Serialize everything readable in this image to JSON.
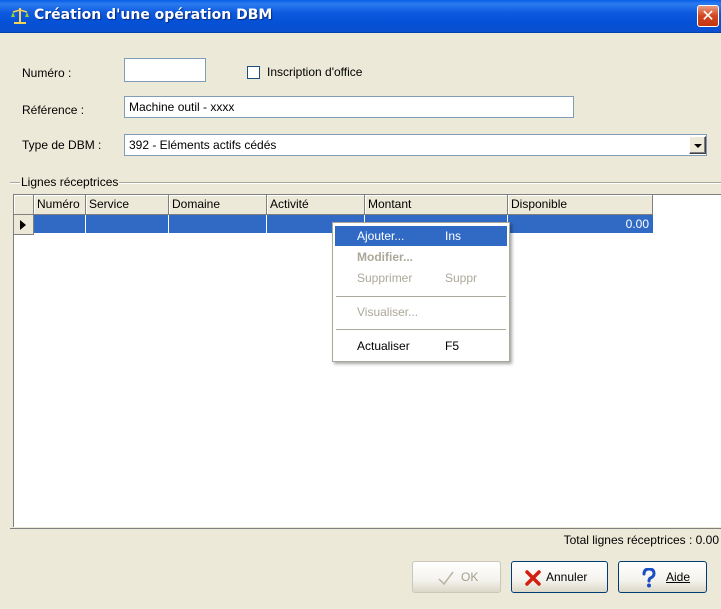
{
  "window": {
    "title": "Création d'une opération DBM",
    "close_glyph": "✕"
  },
  "form": {
    "numero_label": "Numéro :",
    "numero_value": "",
    "inscription_label": "Inscription d'office",
    "inscription_checked": false,
    "reference_label": "Référence :",
    "reference_value": "Machine outil  - xxxx",
    "type_label": "Type de DBM :",
    "type_value": "392 - Eléments actifs cédés"
  },
  "group": {
    "label": "Lignes réceptrices"
  },
  "grid": {
    "columns": [
      "Numéro",
      "Service",
      "Domaine",
      "Activité",
      "Montant",
      "Disponible"
    ],
    "rows": [
      {
        "numero": "",
        "service": "",
        "domaine": "",
        "activite": "",
        "montant": "",
        "disponible": "0.00",
        "selected": true
      }
    ]
  },
  "total": {
    "text": "Total lignes réceptrices : 0.00"
  },
  "context_menu": {
    "items": [
      {
        "label": "Ajouter...",
        "shortcut": "Ins",
        "state": "highlighted"
      },
      {
        "label": "Modifier...",
        "shortcut": "",
        "state": "disabled-bold"
      },
      {
        "label": "Supprimer",
        "shortcut": "Suppr",
        "state": "disabled"
      },
      {
        "label": "Visualiser...",
        "shortcut": "",
        "state": "disabled"
      },
      {
        "label": "Actualiser",
        "shortcut": "F5",
        "state": "enabled"
      }
    ]
  },
  "buttons": {
    "ok": "OK",
    "annuler": "Annuler",
    "aide": "Aide"
  },
  "colors": {
    "titlebar": "#0a54e0",
    "selection": "#316ac5",
    "dialog_bg": "#ece9d8",
    "disabled_text": "#aca899"
  },
  "icons": [
    "app-balance-icon",
    "close-icon",
    "checkmark-icon",
    "cancel-x-icon",
    "help-icon",
    "dropdown-arrow-icon",
    "row-pointer-icon"
  ]
}
